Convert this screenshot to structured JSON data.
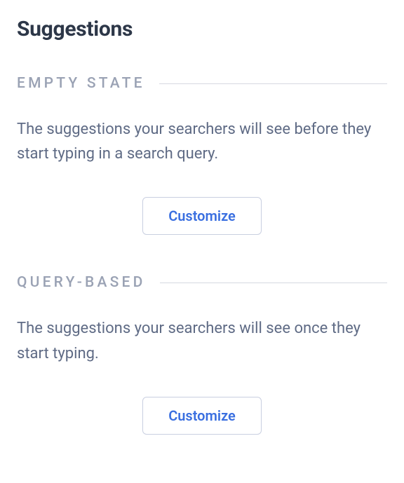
{
  "page": {
    "title": "Suggestions"
  },
  "sections": {
    "empty_state": {
      "label": "EMPTY STATE",
      "description": "The suggestions your searchers will see before they start typing in a search query.",
      "button_label": "Customize"
    },
    "query_based": {
      "label": "QUERY-BASED",
      "description": "The suggestions your searchers will see once they start typing.",
      "button_label": "Customize"
    }
  }
}
